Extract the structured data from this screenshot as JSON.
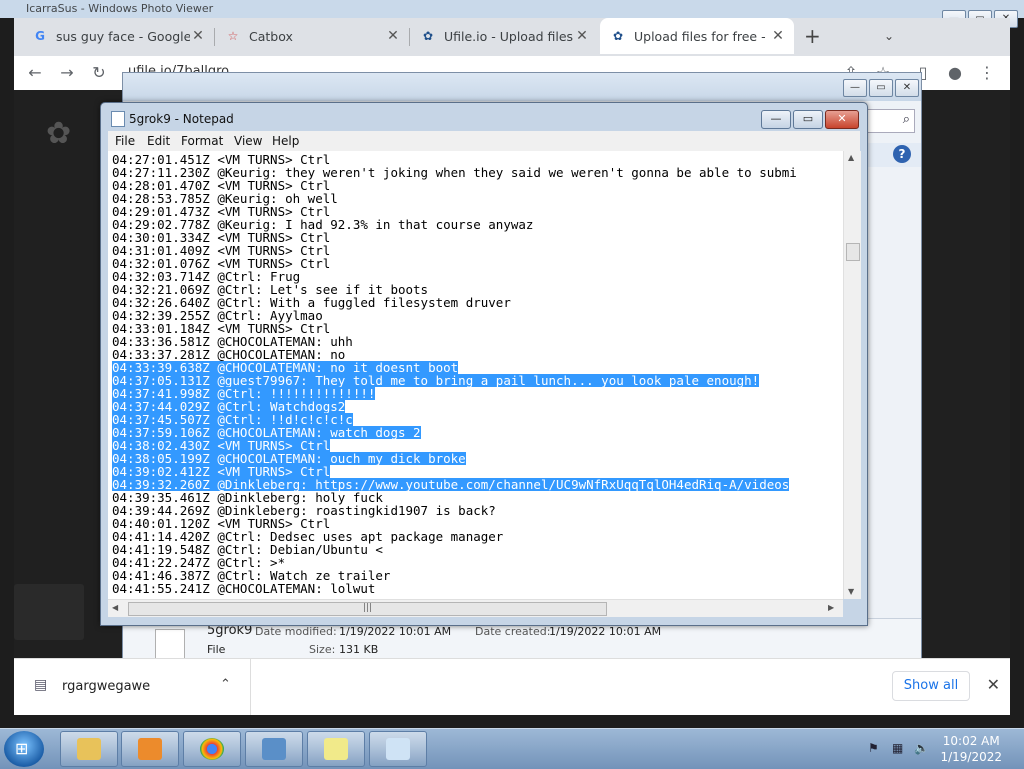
{
  "photo_viewer": {
    "title": "IcarraSus - Windows Photo Viewer"
  },
  "browser": {
    "tabs": [
      {
        "title": "sus guy face - Google Se",
        "icon": "google-icon"
      },
      {
        "title": "Catbox",
        "icon": "catbox-icon"
      },
      {
        "title": "Ufile.io - Upload files fo",
        "icon": "ufile-icon"
      },
      {
        "title": "Upload files for free - rg",
        "icon": "ufile-icon"
      }
    ],
    "new_tab": "+",
    "url": "ufile.io/7ballqro",
    "download_item": "rgargwegawe",
    "show_all": "Show all"
  },
  "explorer": {
    "file_name": "5grok9",
    "file_type": "File",
    "modified_label": "Date modified:",
    "modified_value": "1/19/2022 10:01 AM",
    "created_label": "Date created:",
    "created_value": "1/19/2022 10:01 AM",
    "size_label": "Size:",
    "size_value": "131 KB"
  },
  "notepad": {
    "title": "5grok9 - Notepad",
    "menu": [
      "File",
      "Edit",
      "Format",
      "View",
      "Help"
    ],
    "lines": [
      {
        "text": "04:27:01.451Z <VM TURNS> Ctrl",
        "sel": false
      },
      {
        "text": "04:27:11.230Z @Keurig: they weren't joking when they said we weren't gonna be able to submi",
        "sel": false
      },
      {
        "text": "04:28:01.470Z <VM TURNS> Ctrl",
        "sel": false
      },
      {
        "text": "04:28:53.785Z @Keurig: oh well",
        "sel": false
      },
      {
        "text": "04:29:01.473Z <VM TURNS> Ctrl",
        "sel": false
      },
      {
        "text": "04:29:02.778Z @Keurig: I had 92.3% in that course anywaz",
        "sel": false
      },
      {
        "text": "04:30:01.334Z <VM TURNS> Ctrl",
        "sel": false
      },
      {
        "text": "04:31:01.409Z <VM TURNS> Ctrl",
        "sel": false
      },
      {
        "text": "04:32:01.076Z <VM TURNS> Ctrl",
        "sel": false
      },
      {
        "text": "04:32:03.714Z @Ctrl: Frug",
        "sel": false
      },
      {
        "text": "04:32:21.069Z @Ctrl: Let's see if it boots",
        "sel": false
      },
      {
        "text": "04:32:26.640Z @Ctrl: With a fuggled filesystem druver",
        "sel": false
      },
      {
        "text": "04:32:39.255Z @Ctrl: Ayylmao",
        "sel": false
      },
      {
        "text": "04:33:01.184Z <VM TURNS> Ctrl",
        "sel": false
      },
      {
        "text": "04:33:36.581Z @CHOCOLATEMAN: uhh",
        "sel": false
      },
      {
        "text": "04:33:37.281Z @CHOCOLATEMAN: no",
        "sel": false
      },
      {
        "text": "04:33:39.638Z @CHOCOLATEMAN: no it doesnt boot",
        "sel": true
      },
      {
        "text": "04:37:05.131Z @guest79967: They told me to bring a pail lunch... you look pale enough!",
        "sel": true
      },
      {
        "text": "04:37:41.998Z @Ctrl: !!!!!!!!!!!!!!",
        "sel": true
      },
      {
        "text": "04:37:44.029Z @Ctrl: Watchdogs2",
        "sel": true
      },
      {
        "text": "04:37:45.507Z @Ctrl: !!d!c!c!c!c",
        "sel": true
      },
      {
        "text": "04:37:59.106Z @CHOCOLATEMAN: watch_dogs 2",
        "sel": true
      },
      {
        "text": "04:38:02.430Z <VM TURNS> Ctrl",
        "sel": true
      },
      {
        "text": "04:38:05.199Z @CHOCOLATEMAN: ouch my dick broke",
        "sel": true
      },
      {
        "text": "04:39:02.412Z <VM TURNS> Ctrl",
        "sel": true
      },
      {
        "text": "04:39:32.260Z @Dinkleberg: https://www.youtube.com/channel/UC9wNfRxUqqTqlOH4edRiq-A/videos",
        "sel": true
      },
      {
        "text": "04:39:35.461Z @Dinkleberg: holy fuck",
        "sel": false
      },
      {
        "text": "04:39:44.269Z @Dinkleberg: roastingkid1907 is back?",
        "sel": false
      },
      {
        "text": "04:40:01.120Z <VM TURNS> Ctrl",
        "sel": false
      },
      {
        "text": "04:41:14.420Z @Ctrl: Dedsec uses apt package manager",
        "sel": false
      },
      {
        "text": "04:41:19.548Z @Ctrl: Debian/Ubuntu <",
        "sel": false
      },
      {
        "text": "04:41:22.247Z @Ctrl: >*",
        "sel": false
      },
      {
        "text": "04:41:46.387Z @Ctrl: Watch ze trailer",
        "sel": false
      },
      {
        "text": "04:41:55.241Z @CHOCOLATEMAN: lolwut",
        "sel": false
      }
    ]
  },
  "taskbar": {
    "time": "10:02 AM",
    "date": "1/19/2022"
  }
}
